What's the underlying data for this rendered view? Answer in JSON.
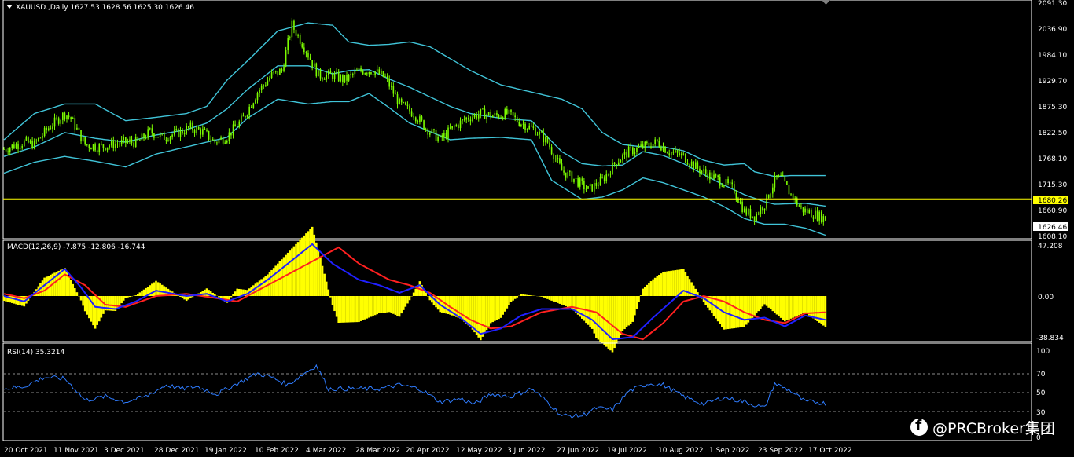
{
  "colors": {
    "background": "#000000",
    "panel_border": "#ffffff",
    "grid": "#8a8a8a",
    "candle": "#7cfc00",
    "bands": "#40c4d8",
    "hline": "#ffff00",
    "macd_hist": "#ffff00",
    "macd_line": "#2020ff",
    "signal_line": "#ff2020",
    "rsi": "#2f7cff"
  },
  "price_panel": {
    "header": "XAUUSD.,Daily  1627.53 1628.56 1625.30 1626.46",
    "price_ticks": [
      "2091.30",
      "2036.90",
      "1984.10",
      "1929.70",
      "1875.30",
      "1822.50",
      "1768.10",
      "1715.30",
      "1660.90",
      "1608.10"
    ],
    "hline_label": "1680.26",
    "current_label": "1626.46"
  },
  "macd_panel": {
    "header": "MACD(12,26,9) -7.875 -12.806 -16.744",
    "ticks": [
      "47.208",
      "0.00",
      "-38.834"
    ]
  },
  "rsi_panel": {
    "header": "RSI(14) 35.3214",
    "ticks": [
      "100",
      "70",
      "50",
      "30",
      "0"
    ]
  },
  "time_axis": [
    "20 Oct 2021",
    "11 Nov 2021",
    "3 Dec 2021",
    "28 Dec 2021",
    "19 Jan 2022",
    "10 Feb 2022",
    "4 Mar 2022",
    "28 Mar 2022",
    "20 Apr 2022",
    "12 May 2022",
    "3 Jun 2022",
    "27 Jun 2022",
    "19 Jul 2022",
    "10 Aug 2022",
    "1 Sep 2022",
    "23 Sep 2022",
    "17 Oct 2022"
  ],
  "watermark": {
    "text": "@PRCBroker集团"
  },
  "chart_data": [
    {
      "type": "candlestick",
      "title": "XAUUSD.,Daily",
      "ohlc_last": {
        "open": 1627.53,
        "high": 1628.56,
        "low": 1625.3,
        "close": 1626.46
      },
      "ylim": [
        1595,
        2100
      ],
      "close_path": [
        [
          0,
          1785
        ],
        [
          10,
          1800
        ],
        [
          15,
          1795
        ],
        [
          22,
          1830
        ],
        [
          30,
          1860
        ],
        [
          33,
          1850
        ],
        [
          40,
          1795
        ],
        [
          47,
          1790
        ],
        [
          53,
          1795
        ],
        [
          60,
          1800
        ],
        [
          66,
          1800
        ],
        [
          72,
          1822
        ],
        [
          78,
          1810
        ],
        [
          85,
          1818
        ],
        [
          92,
          1830
        ],
        [
          98,
          1822
        ],
        [
          104,
          1800
        ],
        [
          110,
          1812
        ],
        [
          118,
          1850
        ],
        [
          125,
          1905
        ],
        [
          132,
          1940
        ],
        [
          137,
          1950
        ],
        [
          142,
          2045
        ],
        [
          148,
          2000
        ],
        [
          155,
          1940
        ],
        [
          162,
          1940
        ],
        [
          168,
          1930
        ],
        [
          175,
          1950
        ],
        [
          182,
          1950
        ],
        [
          188,
          1935
        ],
        [
          195,
          1880
        ],
        [
          202,
          1860
        ],
        [
          208,
          1830
        ],
        [
          215,
          1805
        ],
        [
          220,
          1825
        ],
        [
          228,
          1850
        ],
        [
          235,
          1860
        ],
        [
          242,
          1855
        ],
        [
          248,
          1860
        ],
        [
          255,
          1840
        ],
        [
          262,
          1825
        ],
        [
          268,
          1800
        ],
        [
          275,
          1740
        ],
        [
          282,
          1720
        ],
        [
          288,
          1700
        ],
        [
          295,
          1720
        ],
        [
          302,
          1760
        ],
        [
          308,
          1780
        ],
        [
          315,
          1790
        ],
        [
          322,
          1800
        ],
        [
          328,
          1780
        ],
        [
          335,
          1770
        ],
        [
          342,
          1745
        ],
        [
          348,
          1730
        ],
        [
          355,
          1715
        ],
        [
          360,
          1700
        ],
        [
          365,
          1655
        ],
        [
          370,
          1645
        ],
        [
          375,
          1670
        ],
        [
          380,
          1720
        ],
        [
          383,
          1725
        ],
        [
          388,
          1690
        ],
        [
          393,
          1660
        ],
        [
          400,
          1648
        ],
        [
          405,
          1640
        ]
      ],
      "bollinger": {
        "upper": [
          [
            0,
            1805
          ],
          [
            15,
            1860
          ],
          [
            30,
            1880
          ],
          [
            45,
            1880
          ],
          [
            60,
            1845
          ],
          [
            75,
            1852
          ],
          [
            90,
            1860
          ],
          [
            100,
            1875
          ],
          [
            110,
            1930
          ],
          [
            120,
            1970
          ],
          [
            135,
            2033
          ],
          [
            150,
            2050
          ],
          [
            162,
            2045
          ],
          [
            170,
            2010
          ],
          [
            180,
            2003
          ],
          [
            190,
            2005
          ],
          [
            200,
            2010
          ],
          [
            210,
            2000
          ],
          [
            220,
            1975
          ],
          [
            230,
            1950
          ],
          [
            245,
            1920
          ],
          [
            260,
            1905
          ],
          [
            265,
            1900
          ],
          [
            275,
            1890
          ],
          [
            285,
            1870
          ],
          [
            295,
            1820
          ],
          [
            305,
            1795
          ],
          [
            315,
            1790
          ],
          [
            325,
            1790
          ],
          [
            335,
            1782
          ],
          [
            345,
            1762
          ],
          [
            355,
            1752
          ],
          [
            365,
            1755
          ],
          [
            370,
            1738
          ],
          [
            380,
            1728
          ],
          [
            388,
            1730
          ],
          [
            405,
            1730
          ]
        ],
        "middle": [
          [
            0,
            1770
          ],
          [
            15,
            1790
          ],
          [
            30,
            1820
          ],
          [
            45,
            1808
          ],
          [
            60,
            1800
          ],
          [
            75,
            1815
          ],
          [
            90,
            1826
          ],
          [
            100,
            1840
          ],
          [
            110,
            1870
          ],
          [
            120,
            1910
          ],
          [
            135,
            1960
          ],
          [
            150,
            1960
          ],
          [
            162,
            1943
          ],
          [
            170,
            1950
          ],
          [
            180,
            1952
          ],
          [
            190,
            1932
          ],
          [
            200,
            1915
          ],
          [
            210,
            1895
          ],
          [
            220,
            1875
          ],
          [
            230,
            1860
          ],
          [
            245,
            1850
          ],
          [
            260,
            1845
          ],
          [
            275,
            1780
          ],
          [
            285,
            1755
          ],
          [
            295,
            1750
          ],
          [
            305,
            1752
          ],
          [
            315,
            1780
          ],
          [
            325,
            1772
          ],
          [
            335,
            1755
          ],
          [
            345,
            1732
          ],
          [
            355,
            1710
          ],
          [
            365,
            1690
          ],
          [
            375,
            1675
          ],
          [
            380,
            1670
          ],
          [
            395,
            1672
          ],
          [
            405,
            1666
          ]
        ],
        "lower": [
          [
            0,
            1735
          ],
          [
            15,
            1758
          ],
          [
            30,
            1770
          ],
          [
            45,
            1760
          ],
          [
            60,
            1748
          ],
          [
            75,
            1775
          ],
          [
            90,
            1790
          ],
          [
            100,
            1800
          ],
          [
            110,
            1810
          ],
          [
            120,
            1850
          ],
          [
            135,
            1890
          ],
          [
            150,
            1880
          ],
          [
            162,
            1885
          ],
          [
            170,
            1885
          ],
          [
            180,
            1902
          ],
          [
            190,
            1872
          ],
          [
            200,
            1840
          ],
          [
            210,
            1822
          ],
          [
            220,
            1805
          ],
          [
            230,
            1808
          ],
          [
            245,
            1810
          ],
          [
            260,
            1805
          ],
          [
            270,
            1720
          ],
          [
            285,
            1680
          ],
          [
            295,
            1685
          ],
          [
            305,
            1700
          ],
          [
            315,
            1725
          ],
          [
            325,
            1715
          ],
          [
            335,
            1700
          ],
          [
            345,
            1685
          ],
          [
            355,
            1665
          ],
          [
            365,
            1640
          ],
          [
            375,
            1628
          ],
          [
            385,
            1628
          ],
          [
            395,
            1620
          ],
          [
            405,
            1605
          ]
        ]
      },
      "hline": 1680.26,
      "current_price": 1626.46
    },
    {
      "type": "macd",
      "title": "MACD(12,26,9)",
      "values": {
        "macd": -7.875,
        "signal": -12.806,
        "histogram": -16.744
      },
      "ylim": [
        -45,
        52
      ],
      "macd_path": [
        [
          0,
          0
        ],
        [
          10,
          -5
        ],
        [
          20,
          10
        ],
        [
          30,
          25
        ],
        [
          38,
          8
        ],
        [
          45,
          -10
        ],
        [
          55,
          -12
        ],
        [
          65,
          -5
        ],
        [
          75,
          5
        ],
        [
          90,
          0
        ],
        [
          100,
          2
        ],
        [
          110,
          -5
        ],
        [
          120,
          2
        ],
        [
          130,
          15
        ],
        [
          140,
          30
        ],
        [
          152,
          48
        ],
        [
          162,
          30
        ],
        [
          175,
          15
        ],
        [
          185,
          10
        ],
        [
          195,
          3
        ],
        [
          205,
          10
        ],
        [
          215,
          -8
        ],
        [
          225,
          -20
        ],
        [
          235,
          -35
        ],
        [
          245,
          -30
        ],
        [
          255,
          -18
        ],
        [
          265,
          -12
        ],
        [
          280,
          -12
        ],
        [
          290,
          -22
        ],
        [
          300,
          -40
        ],
        [
          310,
          -38
        ],
        [
          320,
          -20
        ],
        [
          335,
          5
        ],
        [
          345,
          -2
        ],
        [
          355,
          -15
        ],
        [
          365,
          -22
        ],
        [
          375,
          -20
        ],
        [
          385,
          -28
        ],
        [
          395,
          -18
        ],
        [
          405,
          -22
        ]
      ],
      "signal_path": [
        [
          0,
          2
        ],
        [
          10,
          -2
        ],
        [
          20,
          5
        ],
        [
          30,
          20
        ],
        [
          40,
          10
        ],
        [
          50,
          -8
        ],
        [
          60,
          -10
        ],
        [
          75,
          0
        ],
        [
          90,
          2
        ],
        [
          105,
          -2
        ],
        [
          115,
          -5
        ],
        [
          125,
          5
        ],
        [
          140,
          20
        ],
        [
          155,
          35
        ],
        [
          165,
          45
        ],
        [
          175,
          30
        ],
        [
          190,
          15
        ],
        [
          200,
          10
        ],
        [
          210,
          3
        ],
        [
          220,
          -10
        ],
        [
          230,
          -22
        ],
        [
          240,
          -30
        ],
        [
          250,
          -28
        ],
        [
          265,
          -15
        ],
        [
          280,
          -10
        ],
        [
          292,
          -15
        ],
        [
          305,
          -35
        ],
        [
          315,
          -40
        ],
        [
          325,
          -25
        ],
        [
          335,
          -5
        ],
        [
          345,
          0
        ],
        [
          355,
          -5
        ],
        [
          365,
          -15
        ],
        [
          375,
          -22
        ],
        [
          385,
          -25
        ],
        [
          395,
          -16
        ],
        [
          405,
          -15
        ]
      ]
    },
    {
      "type": "line",
      "title": "RSI(14)",
      "value_last": 35.3214,
      "levels": [
        70,
        50,
        30
      ],
      "ylim": [
        0,
        100
      ],
      "rsi_path": [
        [
          0,
          55
        ],
        [
          10,
          58
        ],
        [
          20,
          70
        ],
        [
          30,
          68
        ],
        [
          35,
          55
        ],
        [
          40,
          40
        ],
        [
          50,
          45
        ],
        [
          60,
          38
        ],
        [
          70,
          45
        ],
        [
          80,
          60
        ],
        [
          88,
          55
        ],
        [
          95,
          58
        ],
        [
          105,
          48
        ],
        [
          115,
          62
        ],
        [
          125,
          75
        ],
        [
          132,
          70
        ],
        [
          140,
          60
        ],
        [
          148,
          75
        ],
        [
          154,
          85
        ],
        [
          160,
          55
        ],
        [
          170,
          55
        ],
        [
          185,
          55
        ],
        [
          195,
          60
        ],
        [
          205,
          55
        ],
        [
          215,
          38
        ],
        [
          225,
          42
        ],
        [
          232,
          35
        ],
        [
          240,
          48
        ],
        [
          250,
          45
        ],
        [
          260,
          55
        ],
        [
          268,
          38
        ],
        [
          275,
          20
        ],
        [
          285,
          20
        ],
        [
          292,
          30
        ],
        [
          300,
          28
        ],
        [
          308,
          52
        ],
        [
          318,
          62
        ],
        [
          325,
          60
        ],
        [
          335,
          45
        ],
        [
          345,
          35
        ],
        [
          355,
          44
        ],
        [
          365,
          38
        ],
        [
          375,
          30
        ],
        [
          380,
          62
        ],
        [
          388,
          52
        ],
        [
          395,
          38
        ],
        [
          400,
          38
        ],
        [
          405,
          36
        ]
      ]
    }
  ]
}
